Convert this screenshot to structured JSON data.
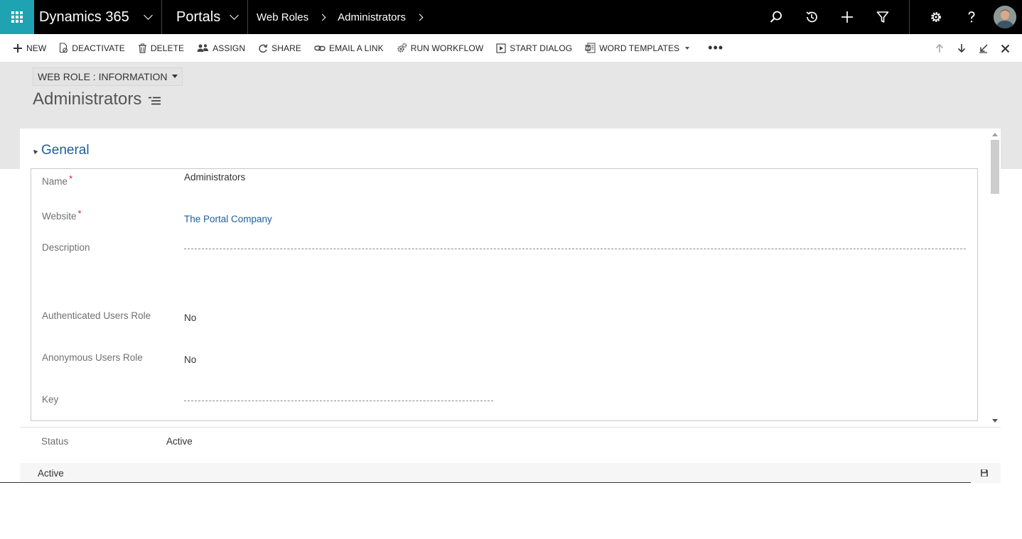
{
  "navbar": {
    "app_name": "Dynamics 365",
    "area_name": "Portals",
    "breadcrumbs": [
      "Web Roles",
      "Administrators"
    ],
    "icons": [
      "search-icon",
      "recent-history-icon",
      "new-plus-icon",
      "advanced-find-filter-icon",
      "settings-gear-icon",
      "help-question-icon",
      "user-avatar"
    ],
    "accent_color": "#1fa3b3"
  },
  "commandbar": {
    "new_label": "NEW",
    "deactivate_label": "DEACTIVATE",
    "delete_label": "DELETE",
    "assign_label": "ASSIGN",
    "share_label": "SHARE",
    "email_link_label": "EMAIL A LINK",
    "run_workflow_label": "RUN WORKFLOW",
    "start_dialog_label": "START DIALOG",
    "word_templates_label": "WORD TEMPLATES",
    "more_label": "•••"
  },
  "header": {
    "form_selector": "WEB ROLE : INFORMATION",
    "record_title": "Administrators"
  },
  "section": {
    "title": "General",
    "fields": {
      "name_label": "Name",
      "name_value": "Administrators",
      "website_label": "Website",
      "website_value": "The Portal Company",
      "description_label": "Description",
      "description_value": "",
      "auth_users_label": "Authenticated Users Role",
      "auth_users_value": "No",
      "anon_users_label": "Anonymous Users Role",
      "anon_users_value": "No",
      "key_label": "Key",
      "key_value": "",
      "required_marker": "*"
    }
  },
  "status": {
    "label": "Status",
    "value": "Active"
  },
  "footer": {
    "record_status": "Active"
  }
}
